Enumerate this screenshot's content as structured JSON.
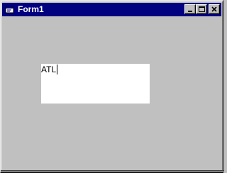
{
  "window": {
    "title": "Form1",
    "icon": "form-app-icon",
    "titlebar_color": "#000080",
    "title_text_color": "#ffffff",
    "face_color": "#c0c0c0"
  },
  "controls": {
    "minimize_icon": "minimize-icon",
    "maximize_icon": "maximize-icon",
    "close_icon": "close-icon"
  },
  "textbox": {
    "value": "ATL",
    "background": "#ffffff"
  }
}
